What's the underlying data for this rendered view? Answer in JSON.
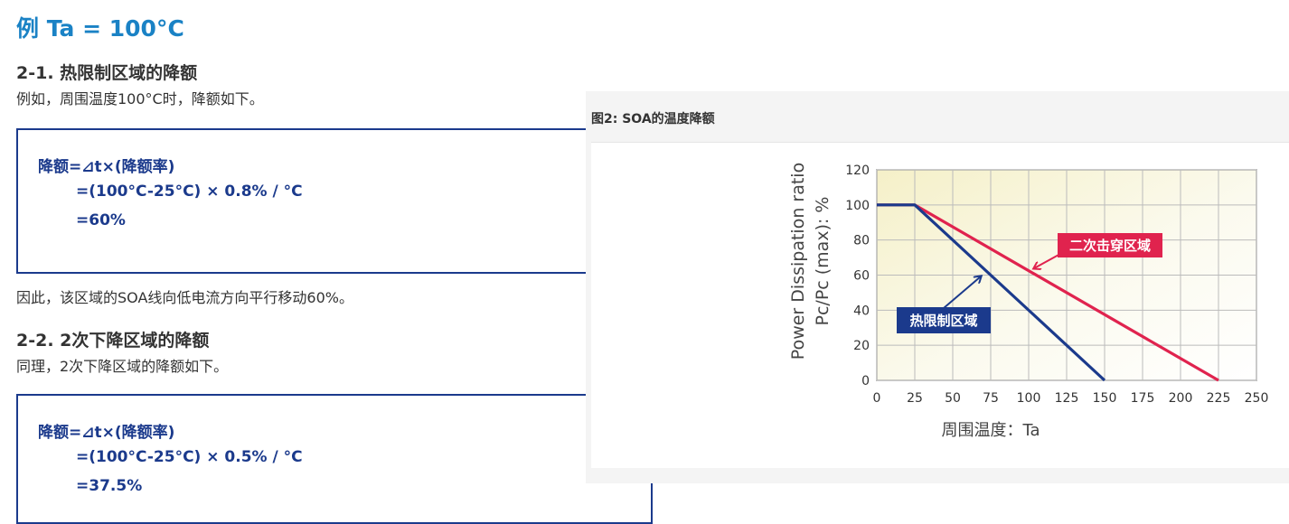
{
  "page_title": "例 Ta = 100°C",
  "section1": {
    "heading": "2-1. 热限制区域的降额",
    "intro": "例如，周围温度100°C时，降额如下。",
    "formula": {
      "line1": "降额=⊿t×(降额率)",
      "line2": "=(100°C-25°C) × 0.8% / °C",
      "line3": "=60%"
    },
    "conclusion": "因此，该区域的SOA线向低电流方向平行移动60%。"
  },
  "section2": {
    "heading": "2-2. 2次下降区域的降额",
    "intro": "同理，2次下降区域的降额如下。",
    "formula": {
      "line1": "降额=⊿t×(降额率)",
      "line2": "=(100°C-25°C) × 0.5% / °C",
      "line3": "=37.5%"
    }
  },
  "figure": {
    "title": "图2: SOA的温度降额"
  },
  "chart_data": {
    "type": "line",
    "xlabel": "周围温度：Ta",
    "ylabel_line1": "Power Dissipation ratio",
    "ylabel_line2": "Pc/Pc (max): %",
    "xlim": [
      0,
      250
    ],
    "ylim": [
      0,
      120
    ],
    "x_ticks": [
      0,
      25,
      50,
      75,
      100,
      125,
      150,
      175,
      200,
      225,
      250
    ],
    "y_ticks": [
      0,
      20,
      40,
      60,
      80,
      100,
      120
    ],
    "grid": true,
    "series": [
      {
        "name": "热限制区域",
        "color": "#1b3a8c",
        "points": [
          [
            0,
            100
          ],
          [
            25,
            100
          ],
          [
            150,
            0
          ]
        ]
      },
      {
        "name": "二次击穿区域",
        "color": "#e0234e",
        "points": [
          [
            0,
            100
          ],
          [
            25,
            100
          ],
          [
            225,
            0
          ]
        ]
      }
    ]
  }
}
